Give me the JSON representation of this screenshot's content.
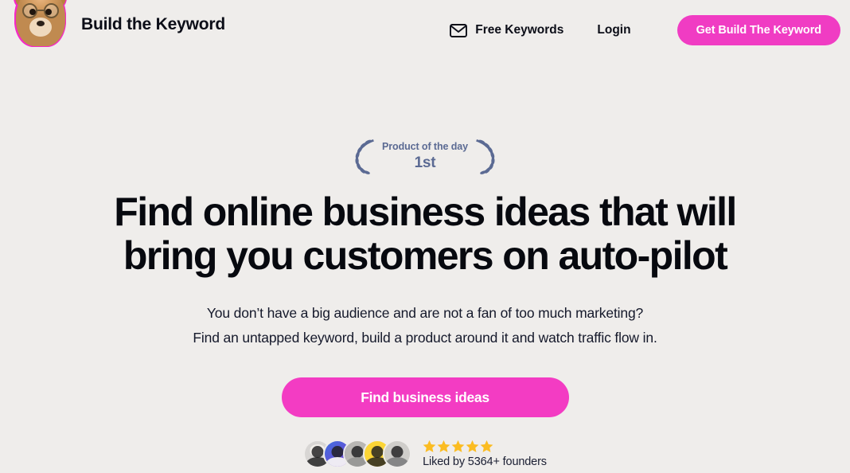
{
  "site": {
    "background_color": "#efedeb",
    "accent_color": "#f03cc3",
    "text_color": "#0b0d17"
  },
  "header": {
    "brand_name": "Build the Keyword",
    "logo_icon": "dog-with-glasses-logo",
    "nav": {
      "mail_icon": "mail-icon",
      "free_keywords_label": "Free Keywords",
      "login_label": "Login",
      "cta_label": "Get Build The Keyword"
    }
  },
  "hero": {
    "badge": {
      "laurel_icon": "laurel-wreath-icon",
      "title": "Product of the day",
      "rank": "1st",
      "color": "#5b6a93"
    },
    "headline": {
      "line1": "Find online business ideas that will",
      "line2": "bring you customers on auto-pilot"
    },
    "subhead": {
      "line1": "You don’t have a big audience and are not a fan of too much marketing?",
      "line2": "Find an untapped keyword, build a product around it and watch traffic flow in."
    },
    "cta_label": "Find business ideas"
  },
  "social_proof": {
    "avatars": [
      {
        "name": "avatar-1",
        "bg": "#d8d6d4"
      },
      {
        "name": "avatar-2",
        "bg": "#3f6fe0"
      },
      {
        "name": "avatar-3",
        "bg": "#b9b7b4"
      },
      {
        "name": "avatar-4",
        "bg": "#fcd535"
      },
      {
        "name": "avatar-5",
        "bg": "#cfcdca"
      }
    ],
    "stars": {
      "count": 5,
      "color": "#fbbc21"
    },
    "liked_text": "Liked by 5364+ founders"
  }
}
